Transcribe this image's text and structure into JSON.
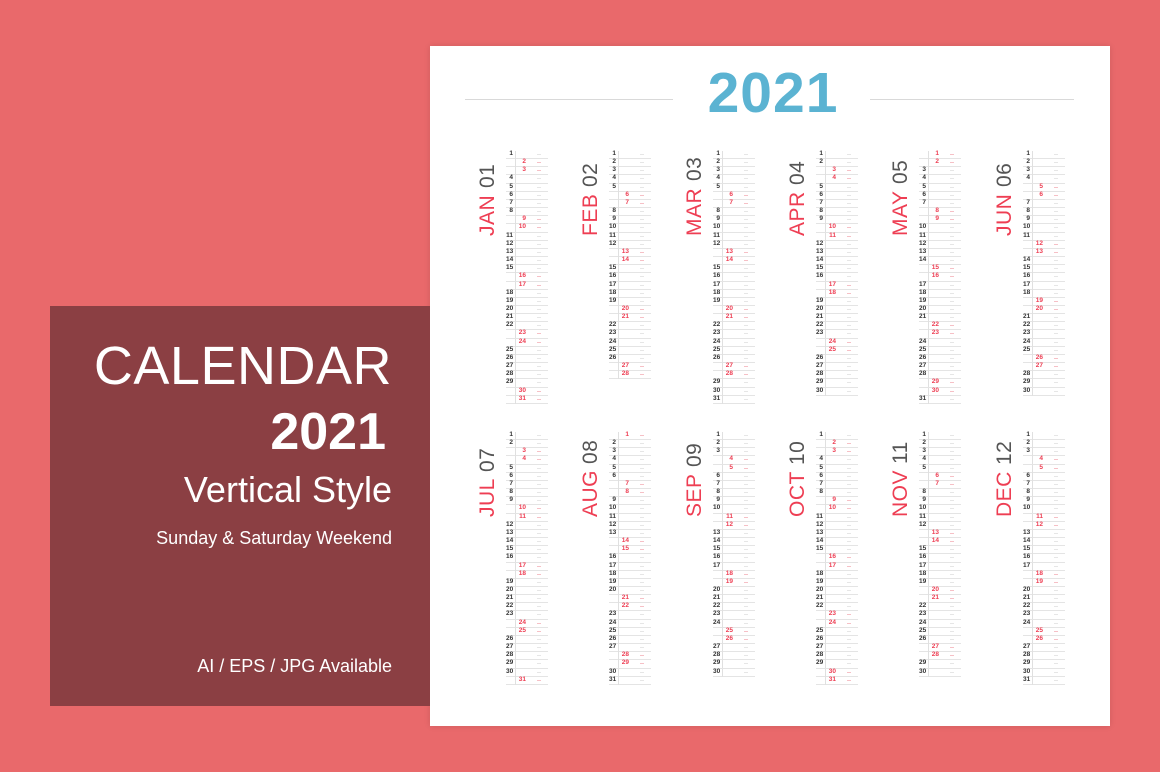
{
  "colors": {
    "background": "#e9696b",
    "panel": "#8b3f43",
    "year_title": "#5bb3d2",
    "weekend": "#ee3e53",
    "weekday": "#333333"
  },
  "panel": {
    "title": "CALENDAR",
    "year": "2021",
    "style": "Vertical Style",
    "weekend_note": "Sunday & Saturday Weekend",
    "formats": "AI / EPS / JPG   Available"
  },
  "calendar": {
    "year": "2021",
    "months": [
      {
        "name": "JAN",
        "num": "01",
        "days": 31,
        "weekends": [
          2,
          3,
          9,
          10,
          16,
          17,
          23,
          24,
          30,
          31
        ]
      },
      {
        "name": "FEB",
        "num": "02",
        "days": 28,
        "weekends": [
          6,
          7,
          13,
          14,
          20,
          21,
          27,
          28
        ]
      },
      {
        "name": "MAR",
        "num": "03",
        "days": 31,
        "weekends": [
          6,
          7,
          13,
          14,
          20,
          21,
          27,
          28
        ]
      },
      {
        "name": "APR",
        "num": "04",
        "days": 30,
        "weekends": [
          3,
          4,
          10,
          11,
          17,
          18,
          24,
          25
        ]
      },
      {
        "name": "MAY",
        "num": "05",
        "days": 31,
        "weekends": [
          1,
          2,
          8,
          9,
          15,
          16,
          22,
          23,
          29,
          30
        ]
      },
      {
        "name": "JUN",
        "num": "06",
        "days": 30,
        "weekends": [
          5,
          6,
          12,
          13,
          19,
          20,
          26,
          27
        ]
      },
      {
        "name": "JUL",
        "num": "07",
        "days": 31,
        "weekends": [
          3,
          4,
          10,
          11,
          17,
          18,
          24,
          25,
          31
        ]
      },
      {
        "name": "AUG",
        "num": "08",
        "days": 31,
        "weekends": [
          1,
          7,
          8,
          14,
          15,
          21,
          22,
          28,
          29
        ]
      },
      {
        "name": "SEP",
        "num": "09",
        "days": 30,
        "weekends": [
          4,
          5,
          11,
          12,
          18,
          19,
          25,
          26
        ]
      },
      {
        "name": "OCT",
        "num": "10",
        "days": 31,
        "weekends": [
          2,
          3,
          9,
          10,
          16,
          17,
          23,
          24,
          30,
          31
        ]
      },
      {
        "name": "NOV",
        "num": "11",
        "days": 30,
        "weekends": [
          6,
          7,
          13,
          14,
          20,
          21,
          27,
          28
        ]
      },
      {
        "name": "DEC",
        "num": "12",
        "days": 31,
        "weekends": [
          4,
          5,
          11,
          12,
          18,
          19,
          25,
          26
        ]
      }
    ]
  }
}
